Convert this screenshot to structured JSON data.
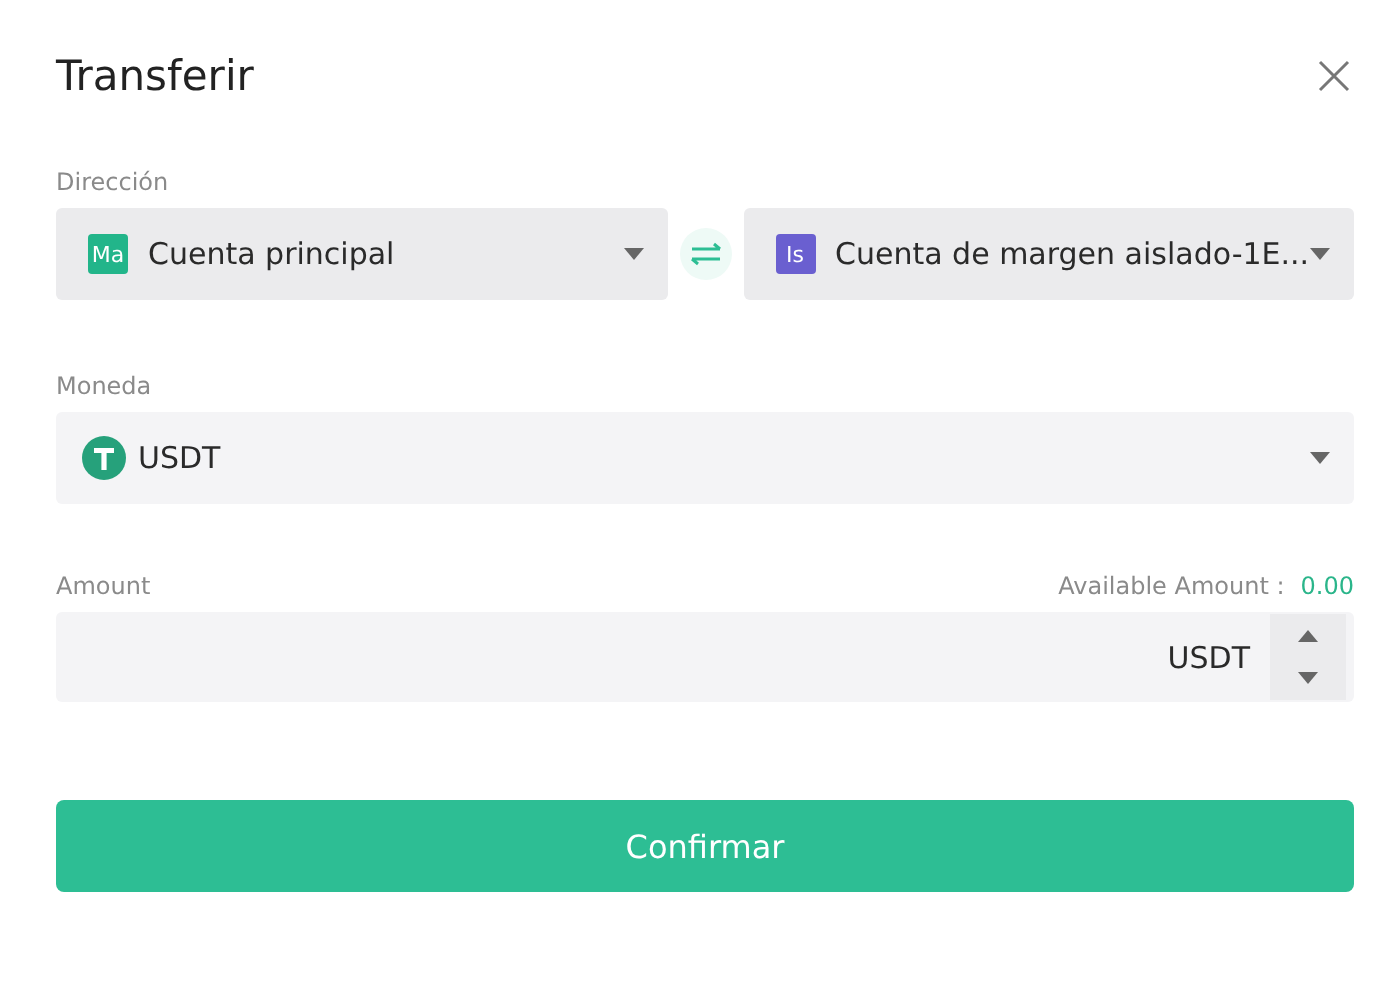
{
  "dialog": {
    "title": "Transferir"
  },
  "direction": {
    "label": "Dirección",
    "from": {
      "badge": "Ma",
      "color": "#22b58a",
      "value": "Cuenta principal"
    },
    "to": {
      "badge": "Is",
      "color": "#6a5fd0",
      "value": "Cuenta de margen aislado-1E..."
    }
  },
  "currency": {
    "label": "Moneda",
    "value": "USDT"
  },
  "amount": {
    "label": "Amount",
    "available_label": "Available Amount :",
    "available_value": "0.00",
    "unit": "USDT"
  },
  "buttons": [
    "Confirmar"
  ]
}
